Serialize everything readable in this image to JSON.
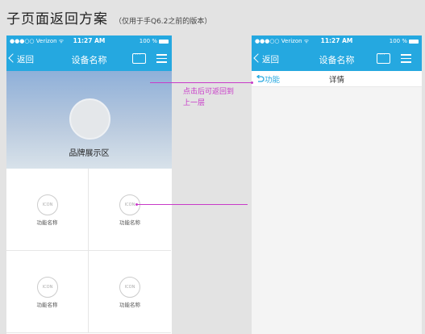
{
  "page": {
    "title": "子页面返回方案",
    "subtitle": "（仅用于手Q6.2之前的版本）"
  },
  "status": {
    "carrier": "●●●○○ Verizon ᯤ",
    "time": "11:27 AM",
    "battery": "100 %"
  },
  "left_phone": {
    "back_label": "返回",
    "title": "设备名称",
    "chat_icon": "chat-icon",
    "menu_icon": "menu-icon",
    "brand_label": "品牌展示区",
    "functions": [
      {
        "icon_text": "ICON",
        "label": "功能名称"
      },
      {
        "icon_text": "ICON",
        "label": "功能名称"
      },
      {
        "icon_text": "ICON",
        "label": "功能名称"
      },
      {
        "icon_text": "ICON",
        "label": "功能名称"
      }
    ]
  },
  "right_phone": {
    "back_label": "返回",
    "title": "设备名称",
    "sub_back_label": "功能",
    "sub_title": "详情"
  },
  "annotation": {
    "line1": "点击后可返回到",
    "line2": "上一层",
    "color": "#c83ac8"
  },
  "colors": {
    "accent": "#25a8e0",
    "background": "#e3e3e3"
  }
}
